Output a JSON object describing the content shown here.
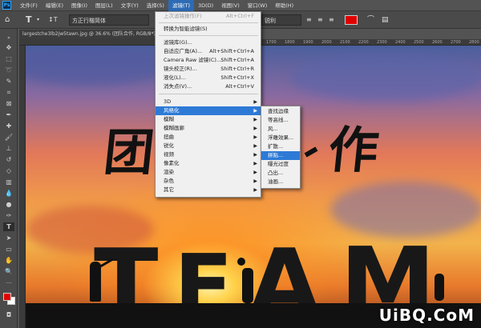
{
  "app": {
    "logo": "Ps"
  },
  "menubar": {
    "items": [
      "文件(F)",
      "编辑(E)",
      "图像(I)",
      "图层(L)",
      "文字(Y)",
      "选择(S)",
      "滤镜(T)",
      "3D(D)",
      "视图(V)",
      "窗口(W)",
      "帮助(H)"
    ],
    "active": "滤镜(T)"
  },
  "options": {
    "font_family": "方正行楷简体",
    "antialias": "锐利",
    "text_color": "#e00000"
  },
  "document": {
    "tab_title": "largestche3lb2jw5tawn.jpg @ 36.6% (团队合作, RGB/8*)"
  },
  "ruler": {
    "ticks": [
      "1700",
      "1800",
      "1900",
      "2000",
      "2100",
      "2200",
      "2300",
      "2400",
      "2500",
      "2600",
      "2700",
      "2800"
    ]
  },
  "filter_menu": {
    "last_filter": {
      "label": "上次滤镜操作(F)",
      "shortcut": "Alt+Ctrl+F"
    },
    "convert_smart": "转换为智能滤镜(S)",
    "filter_gallery": "滤镜库(G)...",
    "adaptive_wide": {
      "label": "自适应广角(A)...",
      "shortcut": "Alt+Shift+Ctrl+A"
    },
    "camera_raw": {
      "label": "Camera Raw 滤镜(C)...",
      "shortcut": "Shift+Ctrl+A"
    },
    "lens_correction": {
      "label": "镜头校正(R)...",
      "shortcut": "Shift+Ctrl+R"
    },
    "liquify": {
      "label": "液化(L)...",
      "shortcut": "Shift+Ctrl+X"
    },
    "vanishing_point": {
      "label": "消失点(V)...",
      "shortcut": "Alt+Ctrl+V"
    },
    "groups": [
      "3D",
      "风格化",
      "模糊",
      "模糊画廊",
      "扭曲",
      "锐化",
      "视频",
      "像素化",
      "渲染",
      "杂色",
      "其它"
    ],
    "highlighted_group": "风格化"
  },
  "stylize_submenu": {
    "items": [
      "查找边缘",
      "等高线...",
      "风...",
      "浮雕效果...",
      "扩散...",
      "拼贴...",
      "曝光过度",
      "凸出...",
      "油画..."
    ],
    "highlighted": "拼贴..."
  },
  "canvas_text": {
    "chinese": [
      "团",
      "作"
    ],
    "team": [
      "T",
      "E",
      "A",
      "M"
    ]
  },
  "watermark": "UiBQ.CoM",
  "colors": {
    "foreground": "#e00000",
    "background": "#ffffff",
    "highlight": "#2d7ad6"
  }
}
